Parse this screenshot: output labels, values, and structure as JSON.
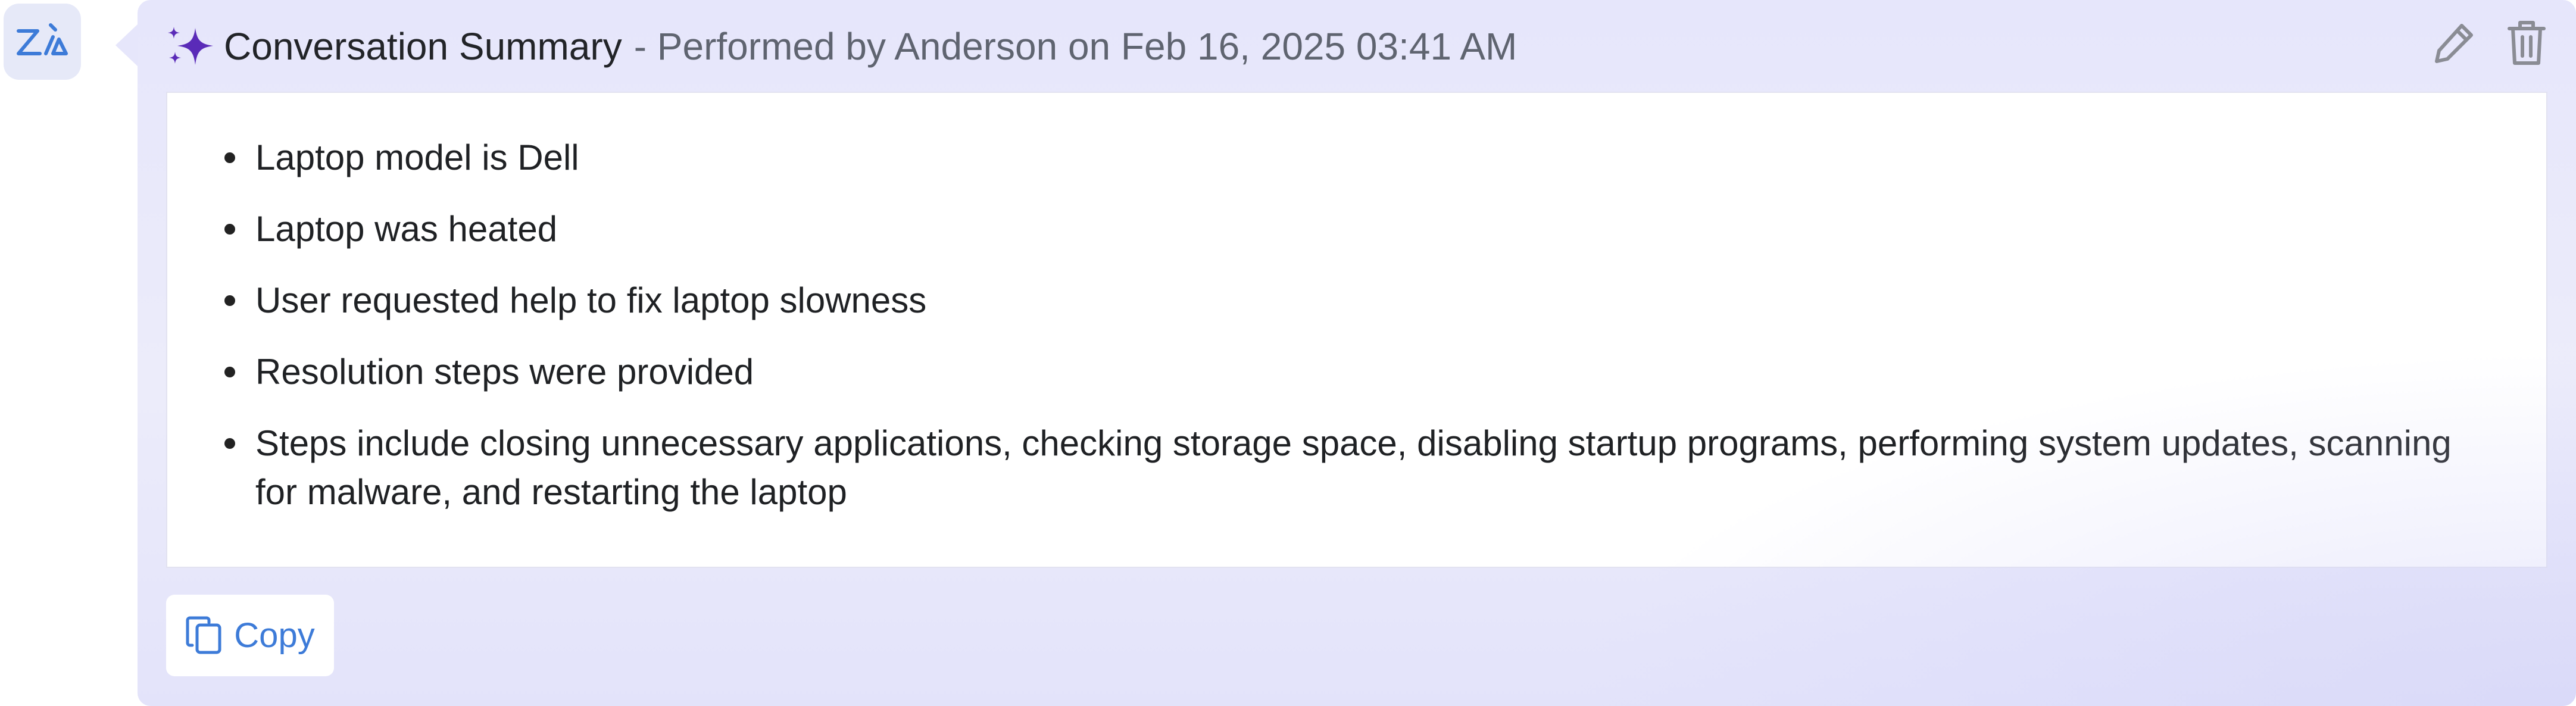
{
  "header": {
    "title": "Conversation Summary",
    "meta": "- Performed by Anderson on Feb 16, 2025 03:41 AM"
  },
  "avatar": {
    "icon": "zia-logo-icon"
  },
  "actions": {
    "edit_icon": "pencil-icon",
    "delete_icon": "trash-icon"
  },
  "summary": {
    "items": [
      "Laptop model is Dell",
      "Laptop was heated",
      "User requested help to fix laptop slowness",
      "Resolution steps were provided",
      "Steps include closing unnecessary applications, checking storage space, disabling startup programs, performing system updates, scanning for malware, and restarting the laptop"
    ]
  },
  "footer": {
    "copy_label": "Copy",
    "copy_icon": "copy-icon"
  },
  "colors": {
    "accent": "#3d7bd8",
    "card_background": "#e6e6fb",
    "sparkle": "#5a2bb8"
  }
}
